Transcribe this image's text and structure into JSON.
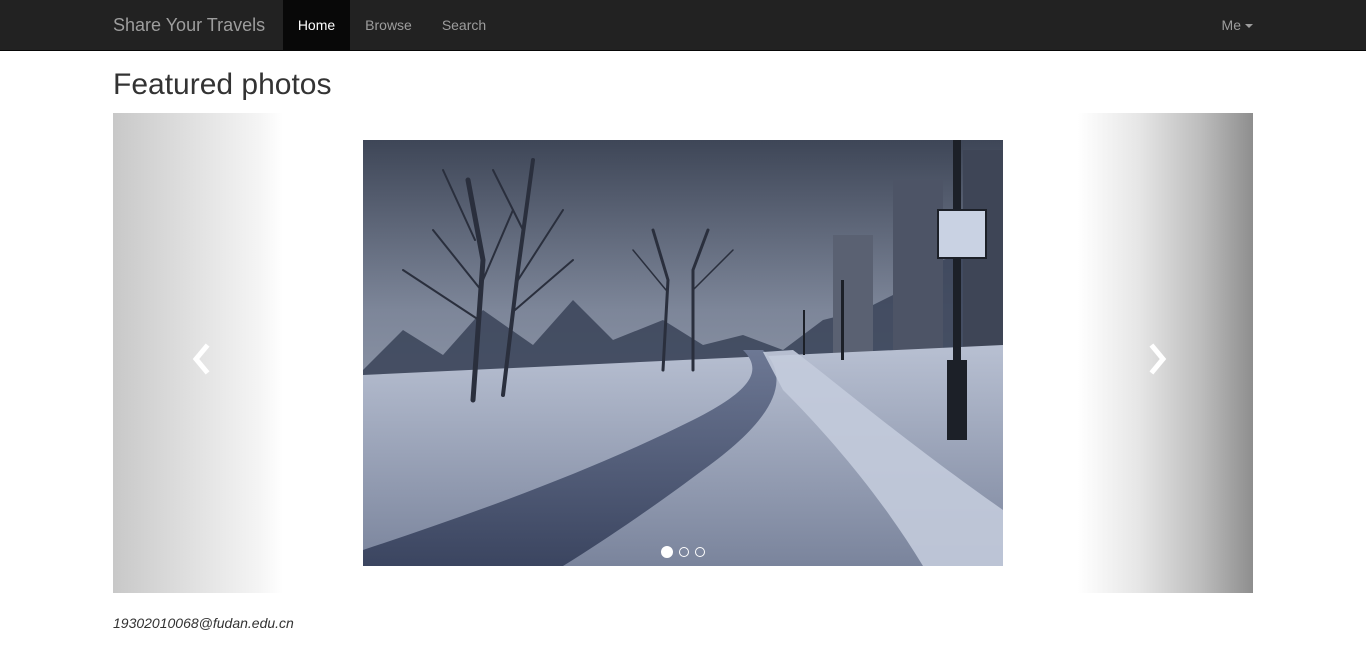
{
  "navbar": {
    "brand": "Share Your Travels",
    "items": [
      {
        "label": "Home",
        "active": true
      },
      {
        "label": "Browse",
        "active": false
      },
      {
        "label": "Search",
        "active": false
      }
    ],
    "user_menu": "Me"
  },
  "main": {
    "title": "Featured photos",
    "carousel": {
      "slide_count": 3,
      "active_slide": 1,
      "slide_image": "snowy-path-photo"
    }
  },
  "footer": {
    "email": "19302010068@fudan.edu.cn"
  },
  "colors": {
    "navbar_bg": "#222222",
    "nav_active_bg": "#080808",
    "nav_text": "#9d9d9d",
    "nav_active_text": "#ffffff"
  }
}
